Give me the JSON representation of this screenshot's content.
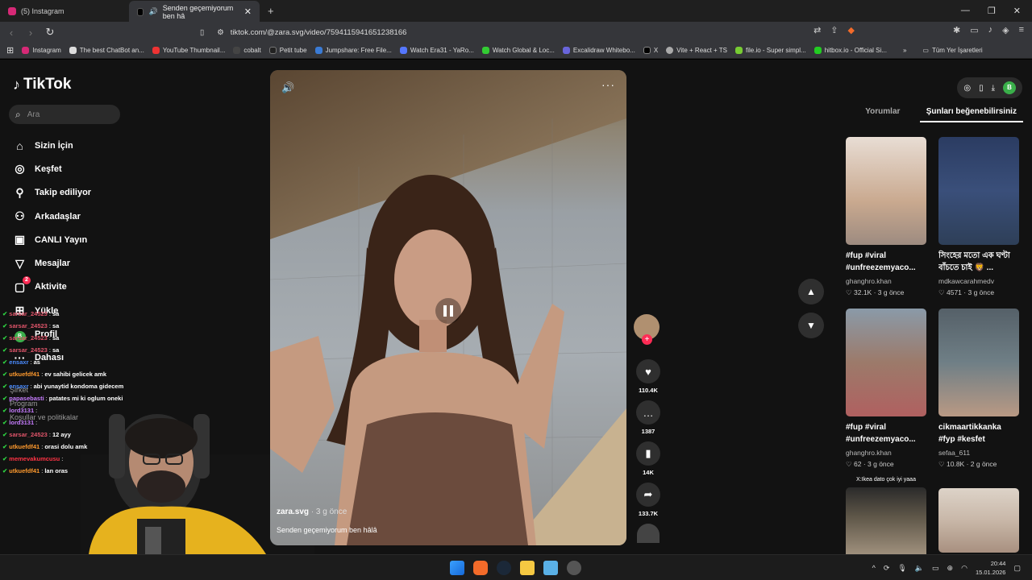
{
  "browser": {
    "tabs": [
      {
        "title": "(5) Instagram"
      },
      {
        "title": "Senden geçemiyorum ben hâ"
      }
    ],
    "url": "tiktok.com/@zara.svg/video/7594115941651238166",
    "bookmarks": [
      "Instagram",
      "The best ChatBot an...",
      "YouTube Thumbnail...",
      "cobalt",
      "Petit tube",
      "Jumpshare: Free File...",
      "Watch Era31 - YaRo...",
      "Watch Global & Loc...",
      "Excalidraw Whitebo...",
      "X",
      "Vite + React + TS",
      "file.io - Super simpl...",
      "hitbox.io - Official Si..."
    ],
    "all_bookmarks": "Tüm Yer İşaretleri"
  },
  "tiktok": {
    "logo": "TikTok",
    "search_placeholder": "Ara",
    "nav": [
      {
        "label": "Sizin İçin",
        "icon": "home-icon"
      },
      {
        "label": "Keşfet",
        "icon": "compass-icon"
      },
      {
        "label": "Takip ediliyor",
        "icon": "user-plus-icon"
      },
      {
        "label": "Arkadaşlar",
        "icon": "friends-icon"
      },
      {
        "label": "CANLI Yayın",
        "icon": "live-icon"
      },
      {
        "label": "Mesajlar",
        "icon": "message-icon"
      },
      {
        "label": "Aktivite",
        "icon": "activity-icon",
        "badge": "2"
      },
      {
        "label": "Yükle",
        "icon": "upload-icon"
      },
      {
        "label": "Profil",
        "icon": "profile-icon"
      },
      {
        "label": "Dahası",
        "icon": "more-icon"
      }
    ],
    "footer": [
      "Şirket",
      "Program",
      "Koşullar ve politikalar"
    ]
  },
  "chat": [
    {
      "user": "sarsar_24523",
      "msg": "sa",
      "color": "#e0556a"
    },
    {
      "user": "sarsar_24523",
      "msg": "sa",
      "color": "#e0556a"
    },
    {
      "user": "sarsar_24523",
      "msg": "sa",
      "color": "#e0556a"
    },
    {
      "user": "sarsar_24523",
      "msg": "sa",
      "color": "#e0556a"
    },
    {
      "user": "ensaxr",
      "msg": "as",
      "color": "#4a8cff"
    },
    {
      "user": "utkuefdf41",
      "msg": "ev sahibi gelicek amk",
      "color": "#ff9a2e"
    },
    {
      "user": "ensaxr",
      "msg": "abi yunaytid kondoma gidecem",
      "color": "#4a8cff"
    },
    {
      "user": "papasebasti",
      "msg": "patates mi ki oglum oneki",
      "color": "#c77dff"
    },
    {
      "user": "lord3131",
      "msg": "",
      "color": "#c77dff"
    },
    {
      "user": "lord3131",
      "msg": "",
      "color": "#c77dff"
    },
    {
      "user": "sarsar_24523",
      "msg": "12 ayy",
      "color": "#e0556a"
    },
    {
      "user": "utkuefdf41",
      "msg": "orasi dolu amk",
      "color": "#ff9a2e"
    },
    {
      "user": "memevakumcusu",
      "msg": "",
      "color": "#ff3344"
    },
    {
      "user": "utkuefdf41",
      "msg": "lan oras",
      "color": "#ff9a2e"
    }
  ],
  "video": {
    "author": "zara.svg",
    "age": "· 3 g önce",
    "caption": "Senden geçemiyorum ben hâlâ",
    "likes": "110.4K",
    "comments": "1387",
    "saves": "14K",
    "shares": "133.7K"
  },
  "right_panel": {
    "tabs": [
      "Yorumlar",
      "Şunları beğenebilirsiniz"
    ],
    "cards": [
      {
        "title": "#fup #viral #unfreezemyaco...",
        "author": "ghanghro.khan",
        "likes": "32.1K",
        "age": "3 g önce",
        "color": "#c9a98f"
      },
      {
        "title": "সিংহের মতো এক ঘণ্টা বাঁচতে চাই 🦁 ...",
        "author": "mdkawcarahmedv",
        "likes": "4571",
        "age": "3 g önce",
        "color": "#3a4f7a"
      },
      {
        "title": "#fup #viral #unfreezemyaco...",
        "author": "ghanghro.khan",
        "likes": "62",
        "age": "3 g önce",
        "color": "#9c7a6a"
      },
      {
        "title": "cikmaartikkanka #fyp #kesfet",
        "author": "sefaa_611",
        "likes": "10.8K",
        "age": "2 g önce",
        "color": "#6f7f86"
      },
      {
        "title": "",
        "author": "",
        "likes": "",
        "age": "",
        "color": "#5e5648",
        "overlay": "X:Ikea dato çok iyi yaaa"
      },
      {
        "title": "",
        "author": "",
        "likes": "",
        "age": "",
        "color": "#c8b7a8"
      }
    ]
  },
  "taskbar": {
    "time": "20:44",
    "date": "15.01.2026"
  }
}
